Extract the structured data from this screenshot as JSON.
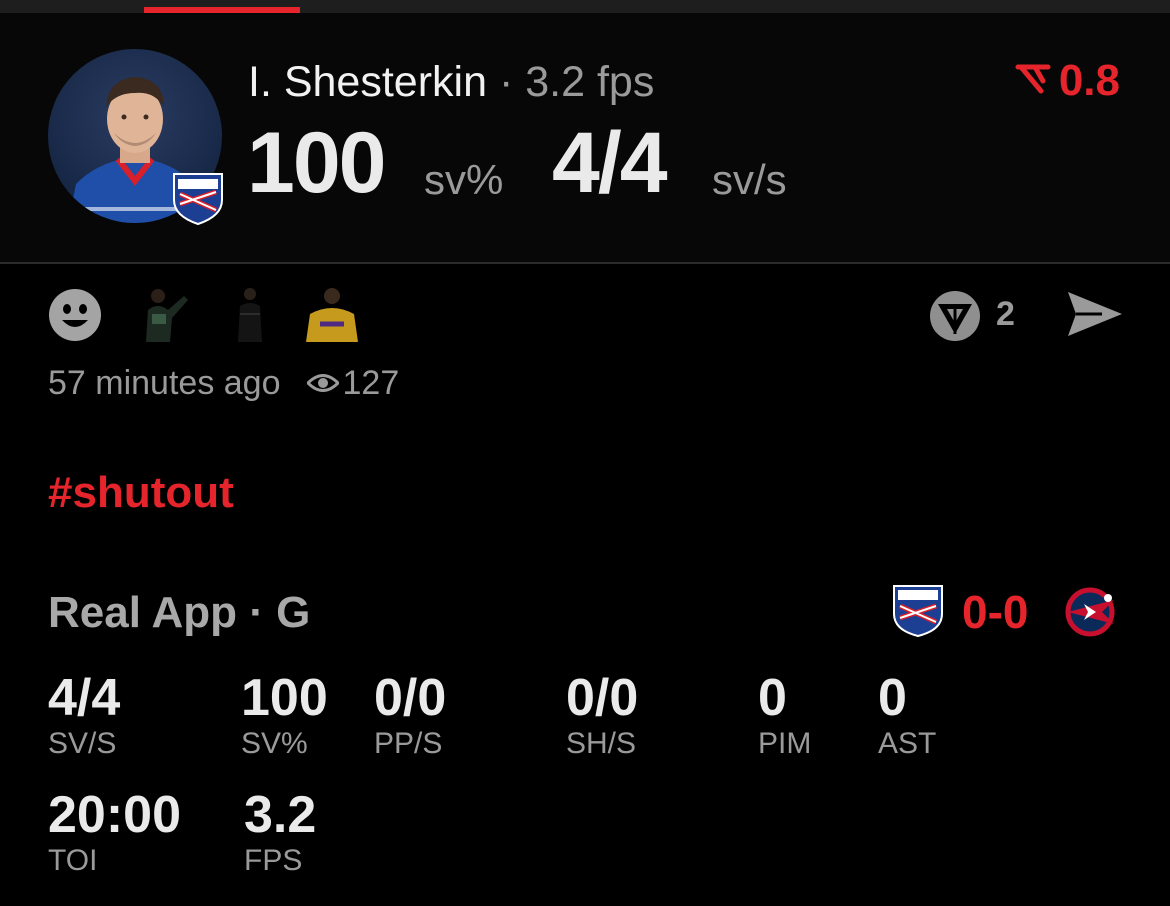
{
  "player": {
    "name": "I. Shesterkin",
    "separator": "·",
    "fps": "3.2 fps",
    "save_pct_value": "100",
    "save_pct_unit": "sv%",
    "saves_value": "4/4",
    "saves_unit": "sv/s"
  },
  "score_change": "0.8",
  "reactions": {
    "reply_count": "2"
  },
  "meta": {
    "time_ago": "57 minutes ago",
    "views": "127"
  },
  "hashtag": "#shutout",
  "game": {
    "label": "Real App · G",
    "score": "0-0"
  },
  "stats_row1": [
    {
      "value": "4/4",
      "label": "SV/S"
    },
    {
      "value": "100",
      "label": "SV%"
    },
    {
      "value": "0/0",
      "label": "PP/S"
    },
    {
      "value": "0/0",
      "label": "SH/S"
    },
    {
      "value": "0",
      "label": "PIM"
    },
    {
      "value": "0",
      "label": "AST"
    }
  ],
  "stats_row2": [
    {
      "value": "20:00",
      "label": "TOI"
    },
    {
      "value": "3.2",
      "label": "FPS"
    }
  ],
  "colors": {
    "accent": "#e5252b",
    "muted": "#9a9a9a",
    "background": "#000000"
  },
  "icons": [
    "emoji-icon",
    "reply-badge-icon",
    "send-icon",
    "eye-icon",
    "rating-arrow-icon"
  ]
}
